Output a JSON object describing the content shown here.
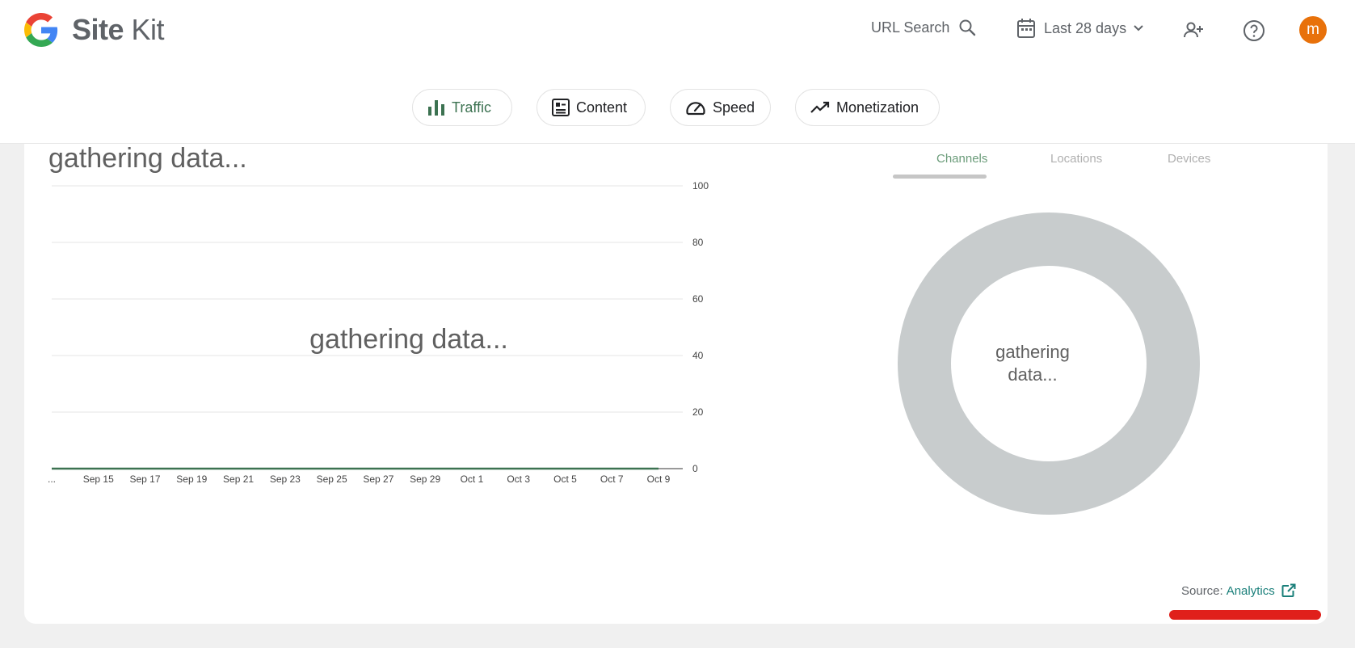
{
  "app": {
    "logo_text_bold": "Site",
    "logo_text_light": "Kit"
  },
  "header": {
    "url_search_label": "URL Search",
    "date_range_label": "Last 28 days",
    "avatar_initial": "m"
  },
  "nav_chips": [
    {
      "label": "Traffic",
      "active": true
    },
    {
      "label": "Content",
      "active": false
    },
    {
      "label": "Speed",
      "active": false
    },
    {
      "label": "Monetization",
      "active": false
    }
  ],
  "card": {
    "title": "gathering data...",
    "chart_overlay_text": "gathering data...",
    "tabs": [
      {
        "label": "Channels",
        "active": true
      },
      {
        "label": "Locations",
        "active": false
      },
      {
        "label": "Devices",
        "active": false
      }
    ],
    "donut_label_line1": "gathering",
    "donut_label_line2": "data...",
    "source_label": "Source:",
    "source_link": "Analytics"
  },
  "colors": {
    "accent_green": "#3c7251",
    "donut_gray": "#c8cccd",
    "avatar_orange": "#e8710a",
    "source_link_teal": "#1a7f7a",
    "highlight_red": "#e0201b"
  },
  "chart_data": {
    "type": "line",
    "x": [
      "...",
      "Sep 15",
      "Sep 17",
      "Sep 19",
      "Sep 21",
      "Sep 23",
      "Sep 25",
      "Sep 27",
      "Sep 29",
      "Oct 1",
      "Oct 3",
      "Oct 5",
      "Oct 7",
      "Oct 9"
    ],
    "series": [
      {
        "values": [
          0,
          0,
          0,
          0,
          0,
          0,
          0,
          0,
          0,
          0,
          0,
          0,
          0,
          0
        ]
      }
    ],
    "yticks": [
      0,
      20,
      40,
      60,
      80,
      100
    ],
    "ylim": [
      0,
      100
    ],
    "grid": true
  }
}
